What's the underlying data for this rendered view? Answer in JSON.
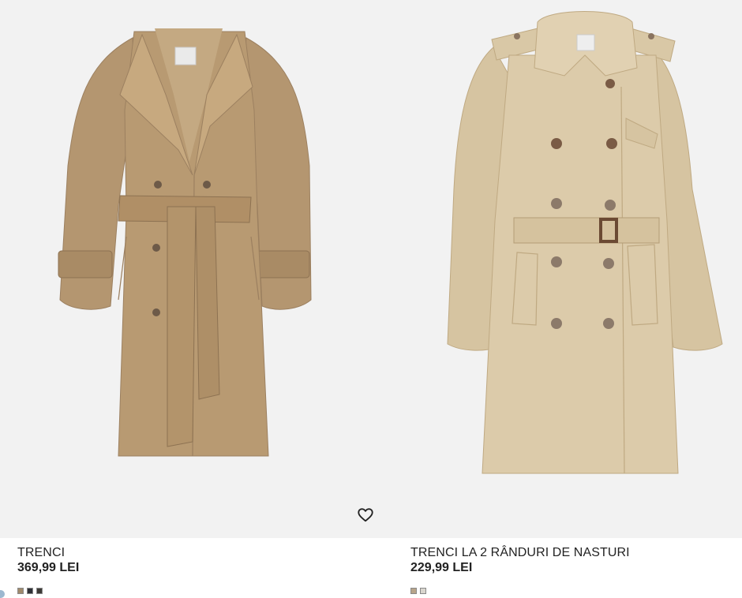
{
  "products": [
    {
      "name": "TRENCI",
      "price": "369,99 LEI",
      "image_icon": "trench-coat-belted-image",
      "swatches": [
        {
          "color": "#a08a6c",
          "label": "beige"
        },
        {
          "color": "#2e3036",
          "label": "navy"
        },
        {
          "color": "#3c3a36",
          "label": "dark-grey"
        }
      ]
    },
    {
      "name": "TRENCI LA 2 RÂNDURI DE NASTURI",
      "price": "229,99 LEI",
      "image_icon": "double-breasted-trench-coat-image",
      "swatches": [
        {
          "color": "#b7a48a",
          "label": "beige"
        },
        {
          "color": "#d9d6ce",
          "label": "light-beige"
        }
      ]
    }
  ],
  "favorite_icon": "heart-outline-icon",
  "colors": {
    "coat1": "#b89a72",
    "coat2": "#dccbaa",
    "image_bg": "#f2f2f2",
    "text": "#222222"
  }
}
